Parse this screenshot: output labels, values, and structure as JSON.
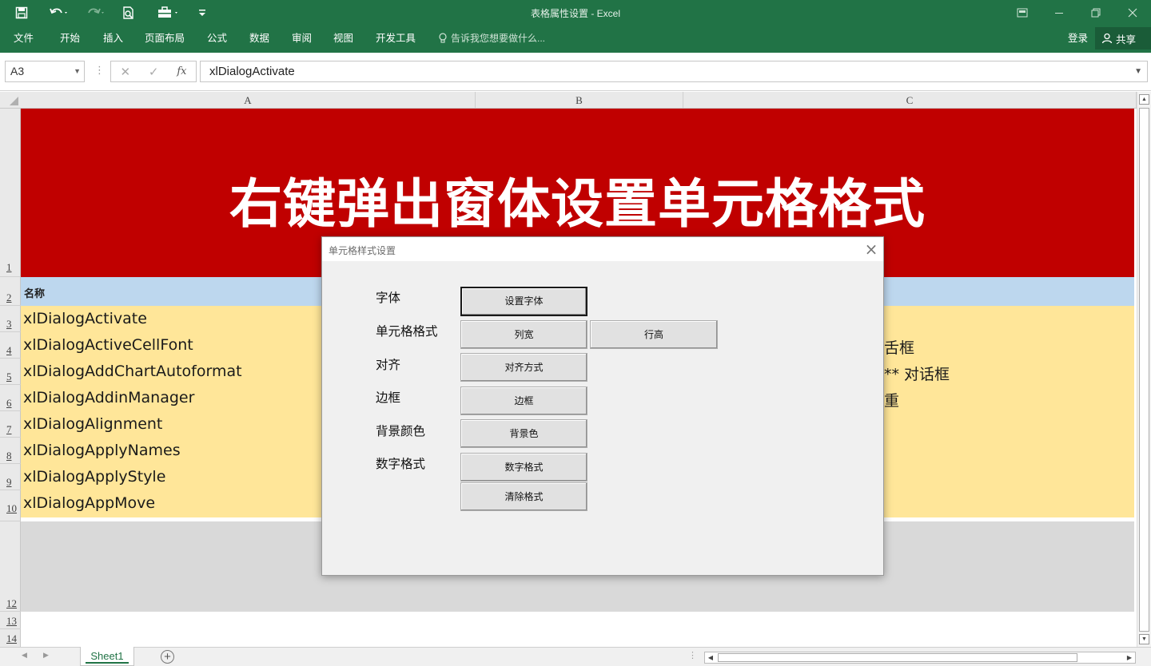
{
  "window": {
    "title": "表格属性设置 - Excel"
  },
  "ribbon": {
    "tabs": [
      "文件",
      "开始",
      "插入",
      "页面布局",
      "公式",
      "数据",
      "审阅",
      "视图",
      "开发工具"
    ],
    "tell_me": "告诉我您想要做什么...",
    "login": "登录",
    "share": "共享"
  },
  "formula_bar": {
    "name_box": "A3",
    "fx_label": "fx",
    "formula": "xlDialogActivate"
  },
  "columns": [
    "A",
    "B",
    "C"
  ],
  "rows": [
    "1",
    "2",
    "3",
    "4",
    "5",
    "6",
    "7",
    "8",
    "9",
    "10",
    "12",
    "13",
    "14"
  ],
  "sheet": {
    "banner_title": "右键弹出窗体设置单元格格式",
    "header_label": "名称",
    "column_a_values": [
      "xlDialogActivate",
      "xlDialogActiveCellFont",
      "xlDialogAddChartAutoformat",
      "xlDialogAddinManager",
      "xlDialogAlignment",
      "xlDialogApplyNames",
      "xlDialogApplyStyle",
      "xlDialogAppMove"
    ],
    "column_c_partial": [
      "舌框",
      "** 对话框",
      "重"
    ]
  },
  "sheet_tabs": {
    "active": "Sheet1",
    "add_label": "+"
  },
  "dialog": {
    "title": "单元格样式设置",
    "labels": [
      "字体",
      "单元格格式",
      "对齐",
      "边框",
      "背景颜色",
      "数字格式"
    ],
    "buttons": {
      "set_font": "设置字体",
      "column_width": "列宽",
      "row_height": "行高",
      "alignment": "对齐方式",
      "border": "边框",
      "background": "背景色",
      "number_format": "数字格式",
      "clear_format": "清除格式"
    }
  },
  "colors": {
    "excel_green": "#217346",
    "banner_red": "#c00000",
    "header_blue": "#bdd7ee",
    "data_yellow": "#ffe699"
  }
}
